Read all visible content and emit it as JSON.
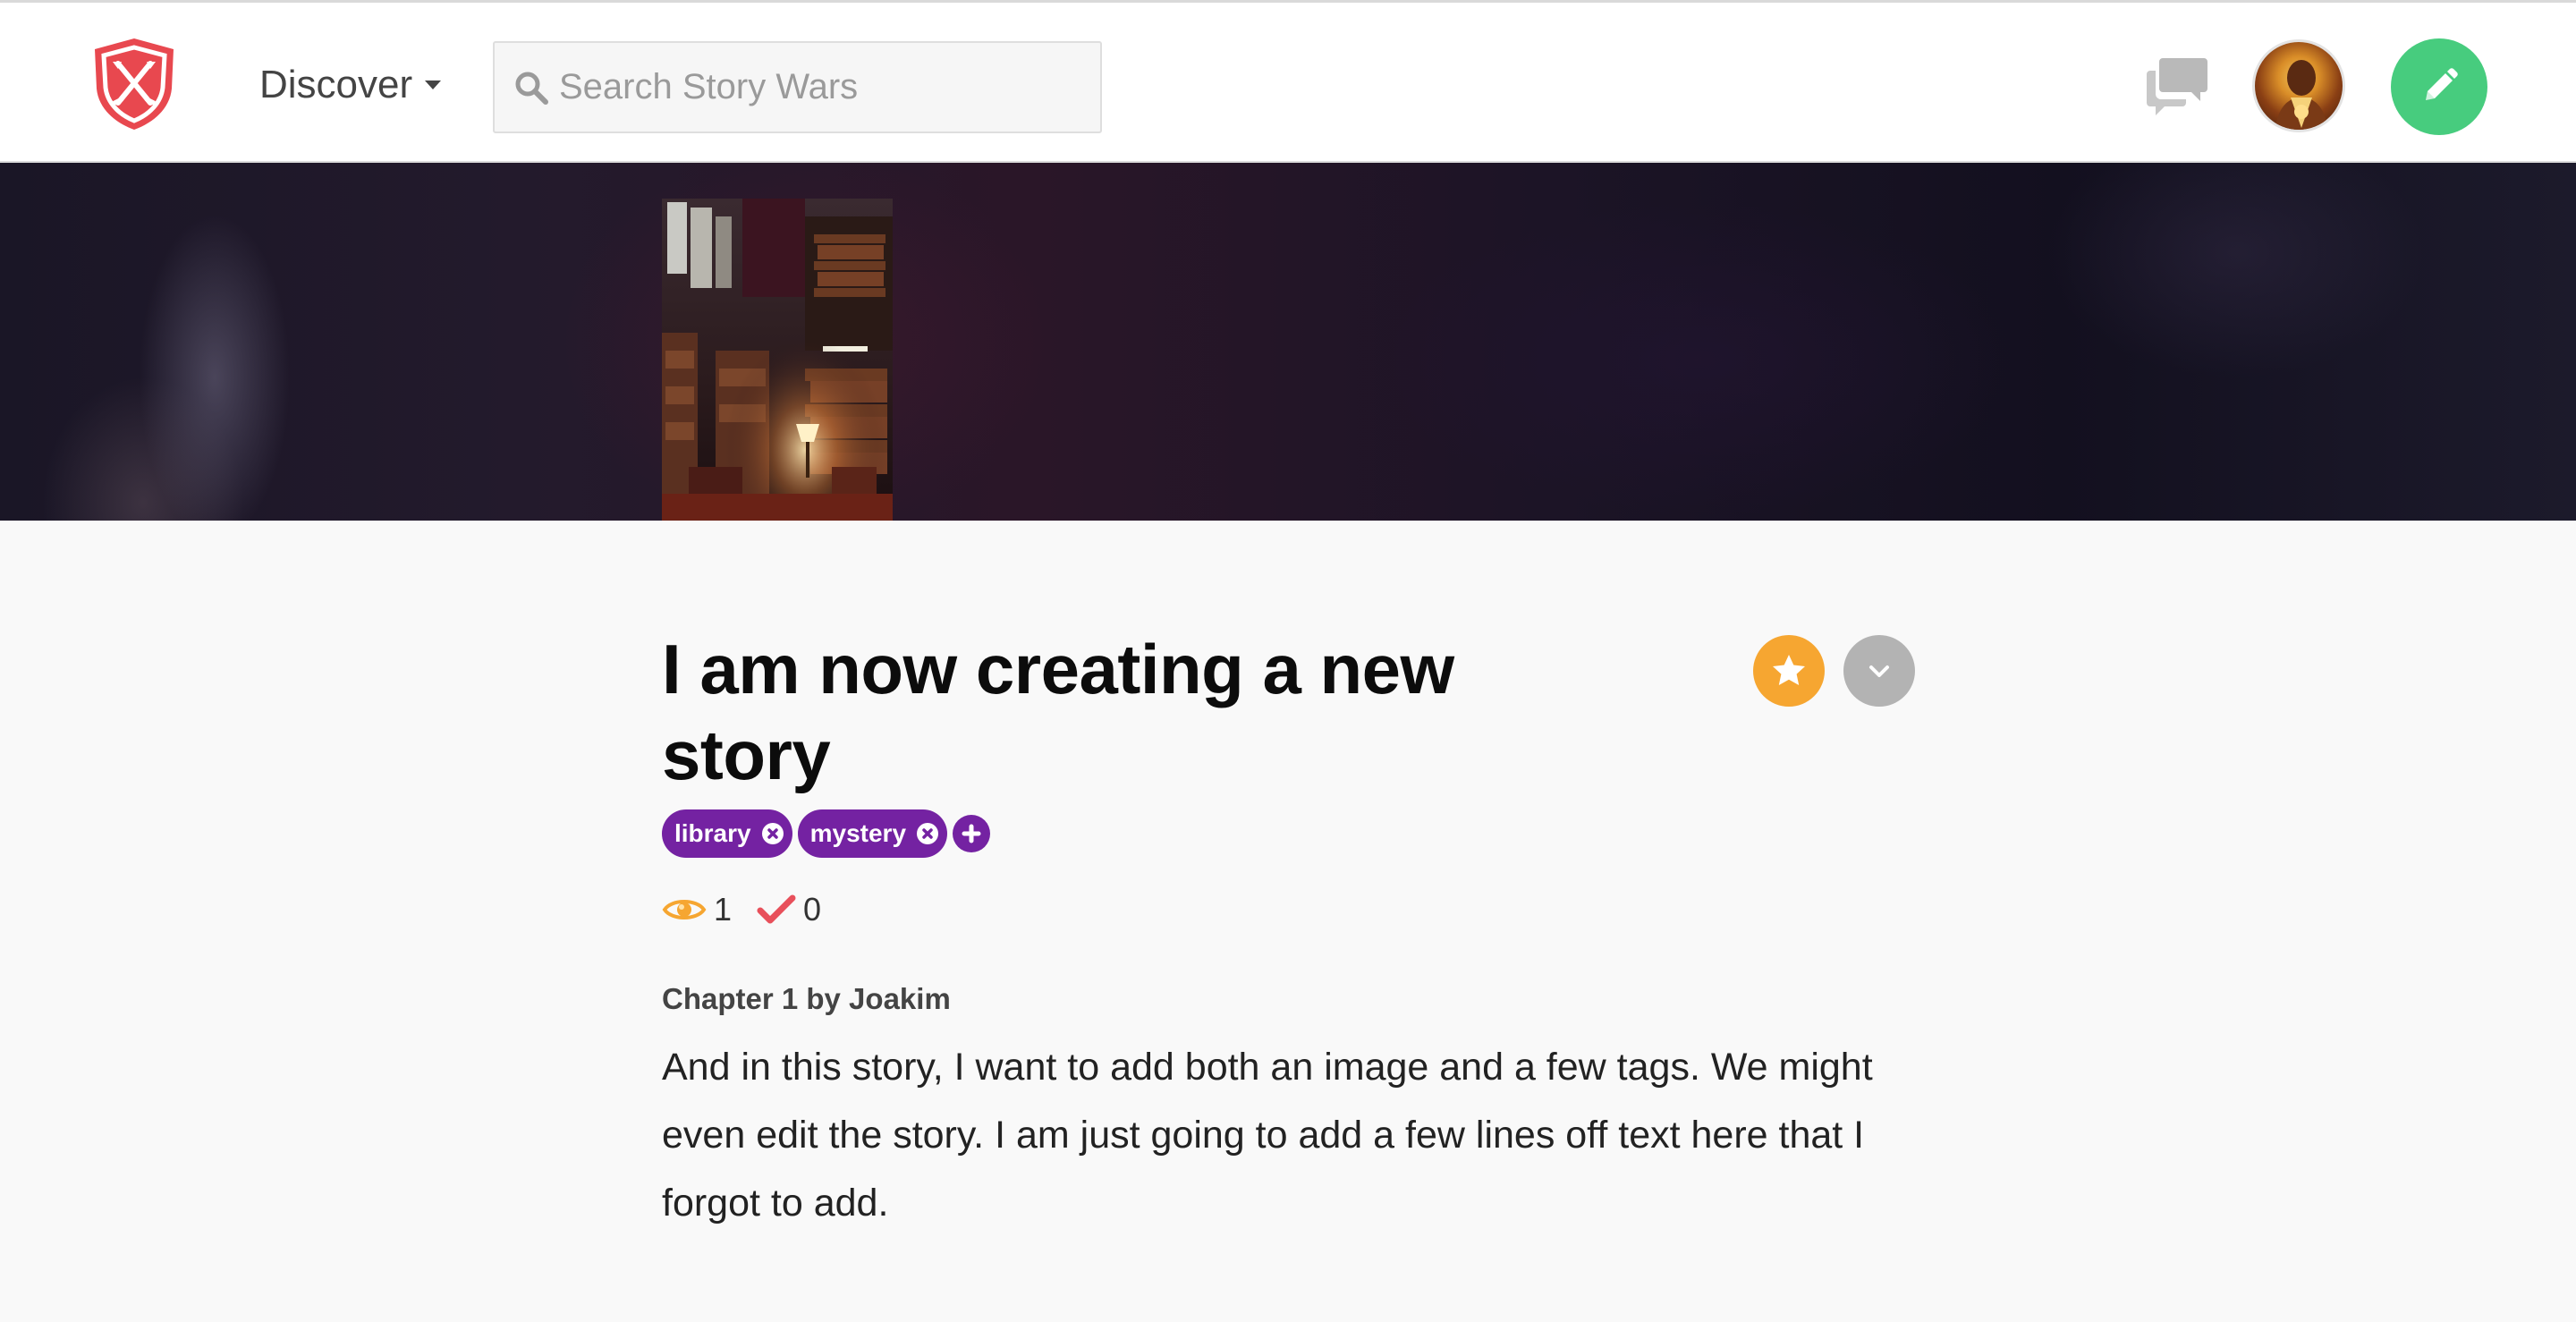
{
  "nav": {
    "discover_label": "Discover",
    "search_placeholder": "Search Story Wars"
  },
  "icons": {
    "logo": "shield-crossed-swords-icon",
    "search": "search-icon",
    "messages": "chat-bubbles-icon",
    "compose": "pencil-icon",
    "favorite": "star-icon",
    "more": "chevron-down-icon",
    "views": "eye-icon",
    "votes": "checkmark-icon"
  },
  "colors": {
    "brand_red": "#e8484f",
    "compose_green": "#47cc7e",
    "favorite_orange": "#f6a631",
    "tag_purple": "#7422a2",
    "vote_red": "#e8505b",
    "more_gray": "#b3b3b3"
  },
  "story": {
    "title": "I am now creating a new story",
    "tags": [
      {
        "label": "library"
      },
      {
        "label": "mystery"
      }
    ],
    "views": "1",
    "votes": "0",
    "chapter_header": "Chapter 1 by Joakim",
    "chapter_text": "And in this story, I want to add both an image and a few tags. We might even edit the story. I am just going to add a few lines off text here that I forgot to add."
  }
}
